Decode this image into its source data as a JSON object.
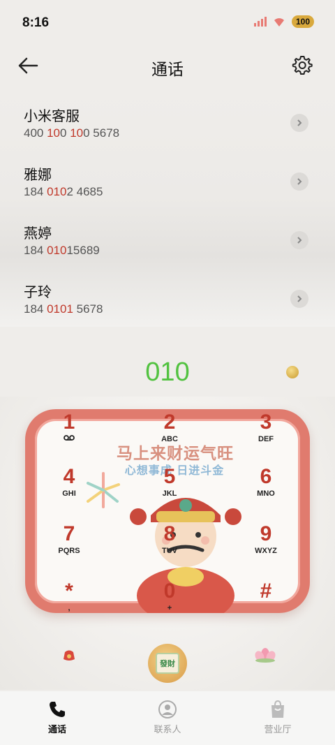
{
  "status_bar": {
    "time": "8:16",
    "battery": "100"
  },
  "header": {
    "title": "通话"
  },
  "contacts": [
    {
      "name": "小米客服",
      "number_parts": [
        "400 ",
        "10",
        "0 ",
        "10",
        "0 5678"
      ]
    },
    {
      "name": "雅娜",
      "number_parts": [
        "184 ",
        "010",
        "2 4685"
      ]
    },
    {
      "name": "燕婷",
      "number_parts": [
        "184 ",
        "010",
        "15689"
      ]
    },
    {
      "name": "子玲",
      "number_parts": [
        "184 ",
        "0101",
        " 5678"
      ]
    }
  ],
  "dialer": {
    "input": "010"
  },
  "keypad": {
    "banner_main": "马上来财运气旺",
    "banner_sub": "心想事成 日进斗金",
    "keys": [
      {
        "digit": "1",
        "letters": "⌂"
      },
      {
        "digit": "2",
        "letters": "ABC"
      },
      {
        "digit": "3",
        "letters": "DEF"
      },
      {
        "digit": "4",
        "letters": "GHI"
      },
      {
        "digit": "5",
        "letters": "JKL"
      },
      {
        "digit": "6",
        "letters": "MNO"
      },
      {
        "digit": "7",
        "letters": "PQRS"
      },
      {
        "digit": "8",
        "letters": "TUV"
      },
      {
        "digit": "9",
        "letters": "WXYZ"
      },
      {
        "digit": "*",
        "letters": ","
      },
      {
        "digit": "0",
        "letters": "+"
      },
      {
        "digit": "#",
        "letters": ""
      }
    ]
  },
  "call_button": {
    "label": "發財"
  },
  "nav": [
    {
      "label": "通话",
      "icon": "phone-icon"
    },
    {
      "label": "联系人",
      "icon": "contacts-icon"
    },
    {
      "label": "营业厅",
      "icon": "store-bag-icon"
    }
  ]
}
